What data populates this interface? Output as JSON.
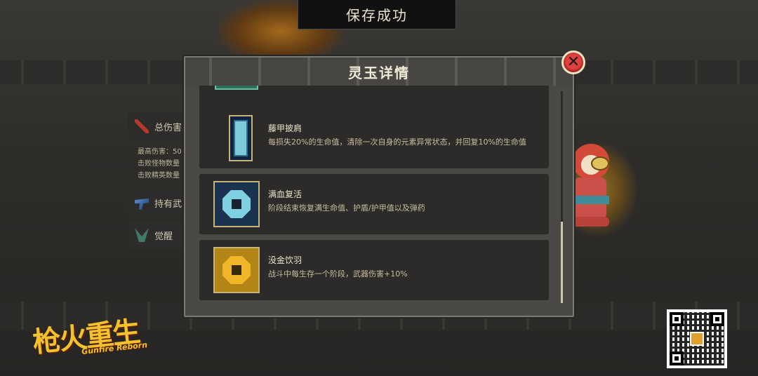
{
  "toast": {
    "text": "保存成功"
  },
  "background": {
    "title": ""
  },
  "left_panel": {
    "total_damage_tab": "总伤害",
    "stats": [
      "最高伤害：50",
      "击败怪物数量",
      "击败精英数量"
    ],
    "weapons_tab": "持有武",
    "awaken_tab": "觉醒"
  },
  "modal": {
    "title": "灵玉详情",
    "close_icon": "close-icon",
    "items": [
      {
        "name": "",
        "description": "",
        "icon": "teal-jade-icon"
      },
      {
        "name": "藤甲披肩",
        "description": "每损失20%的生命值，清除一次自身的元素异常状态，并回复10%的生命值",
        "icon": "rattan-shawl-icon"
      },
      {
        "name": "满血复活",
        "description": "阶段结束恢复满生命值、护盾/护甲值以及弹药",
        "icon": "blue-octagon-icon"
      },
      {
        "name": "没金饮羽",
        "description": "战斗中每生存一个阶段，武器伤害+10%",
        "icon": "gold-octagon-icon"
      }
    ]
  },
  "logo": {
    "cn": "枪火重生",
    "en": "Gunfire Reborn"
  },
  "colors": {
    "accent_gold": "#f3c12b",
    "close_red": "#e04040",
    "panel_bg": "#2c2b29"
  }
}
